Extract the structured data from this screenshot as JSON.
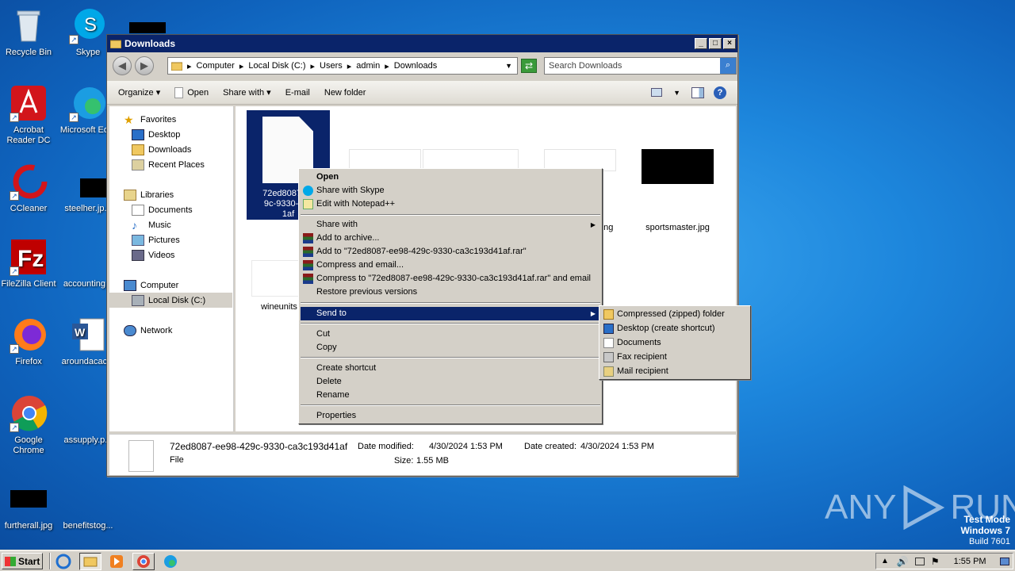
{
  "desktop": {
    "icons": [
      {
        "label": "Recycle Bin"
      },
      {
        "label": "Skype"
      },
      {
        "label": "Acrobat Reader DC"
      },
      {
        "label": "Microsoft Ed..."
      },
      {
        "label": "CCleaner"
      },
      {
        "label": "steelher.jp..."
      },
      {
        "label": "FileZilla Client"
      },
      {
        "label": "accounting..."
      },
      {
        "label": "Firefox"
      },
      {
        "label": "aroundacac..."
      },
      {
        "label": "Google Chrome"
      },
      {
        "label": "assupply.p..."
      },
      {
        "label": "furtherall.jpg"
      },
      {
        "label": "benefitstog..."
      }
    ],
    "watermark": {
      "brand": "ANY",
      "brand2": "RUN",
      "mode": "Test Mode",
      "os": "Windows 7",
      "build": "Build 7601"
    }
  },
  "window": {
    "title": "Downloads",
    "breadcrumb": [
      "Computer",
      "Local Disk (C:)",
      "Users",
      "admin",
      "Downloads"
    ],
    "search_placeholder": "Search Downloads",
    "toolbar": {
      "organize": "Organize",
      "open": "Open",
      "share_with": "Share with",
      "email": "E-mail",
      "new_folder": "New folder"
    },
    "nav": {
      "favorites": "Favorites",
      "desktop": "Desktop",
      "downloads": "Downloads",
      "recent": "Recent Places",
      "libraries": "Libraries",
      "documents": "Documents",
      "music": "Music",
      "pictures": "Pictures",
      "videos": "Videos",
      "computer": "Computer",
      "local_disk": "Local Disk (C:)",
      "network": "Network"
    },
    "files": [
      {
        "name_lines": [
          "72ed8087-ee",
          "9c-9330-ca3",
          "1af"
        ]
      },
      {
        "name": "...ng"
      },
      {
        "name": "sportsmaster.jpg"
      },
      {
        "name": "wineunits"
      }
    ],
    "details": {
      "filename": "72ed8087-ee98-429c-9330-ca3c193d41af",
      "type": "File",
      "modified_label": "Date modified:",
      "modified": "4/30/2024 1:53 PM",
      "created_label": "Date created:",
      "created": "4/30/2024 1:53 PM",
      "size_label": "Size:",
      "size": "1.55 MB"
    }
  },
  "context_menu": {
    "open": "Open",
    "skype": "Share with Skype",
    "notepad": "Edit with Notepad++",
    "share_with": "Share with",
    "add_archive": "Add to archive...",
    "add_rar": "Add to \"72ed8087-ee98-429c-9330-ca3c193d41af.rar\"",
    "compress_email": "Compress and email...",
    "compress_rar_email": "Compress to \"72ed8087-ee98-429c-9330-ca3c193d41af.rar\" and email",
    "restore": "Restore previous versions",
    "send_to": "Send to",
    "cut": "Cut",
    "copy": "Copy",
    "create_shortcut": "Create shortcut",
    "delete": "Delete",
    "rename": "Rename",
    "properties": "Properties"
  },
  "send_to_menu": {
    "zip": "Compressed (zipped) folder",
    "desktop": "Desktop (create shortcut)",
    "documents": "Documents",
    "fax": "Fax recipient",
    "mail": "Mail recipient"
  },
  "taskbar": {
    "start": "Start",
    "time": "1:55 PM"
  }
}
